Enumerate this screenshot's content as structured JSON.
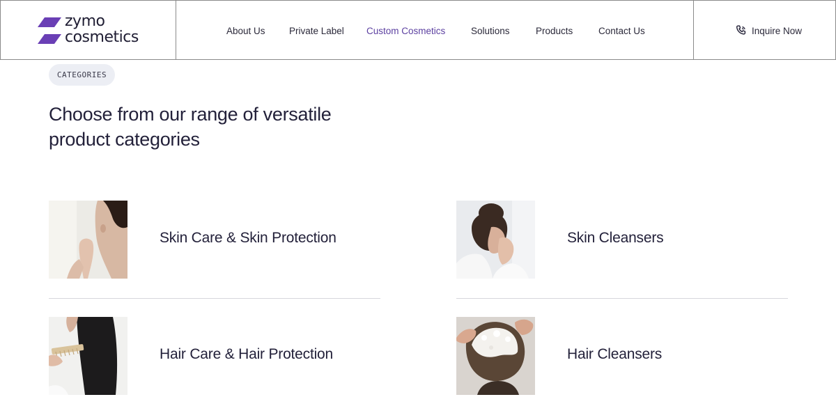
{
  "brand": {
    "name_line1": "zymo",
    "name_line2": "cosmetics",
    "accent": "#6a3fb5"
  },
  "nav": {
    "items": [
      {
        "label": "About Us",
        "active": false
      },
      {
        "label": "Private Label",
        "active": false
      },
      {
        "label": "Custom Cosmetics",
        "active": true
      },
      {
        "label": "Solutions",
        "active": false
      },
      {
        "label": "Products",
        "active": false
      },
      {
        "label": "Contact Us",
        "active": false
      }
    ],
    "cta_label": "Inquire Now",
    "cta_icon": "phone-icon"
  },
  "section": {
    "tag": "CATEGORIES",
    "heading_line1": "Choose from our range of versatile",
    "heading_line2": "product categories"
  },
  "categories": [
    {
      "label": "Skin Care & Skin Protection",
      "image": "woman-touching-neck-photo"
    },
    {
      "label": "Skin Cleansers",
      "image": "woman-washing-face-photo"
    },
    {
      "label": "Hair Care & Hair Protection",
      "image": "woman-combing-hair-photo"
    },
    {
      "label": "Hair Cleansers",
      "image": "shampooing-hair-photo"
    }
  ]
}
